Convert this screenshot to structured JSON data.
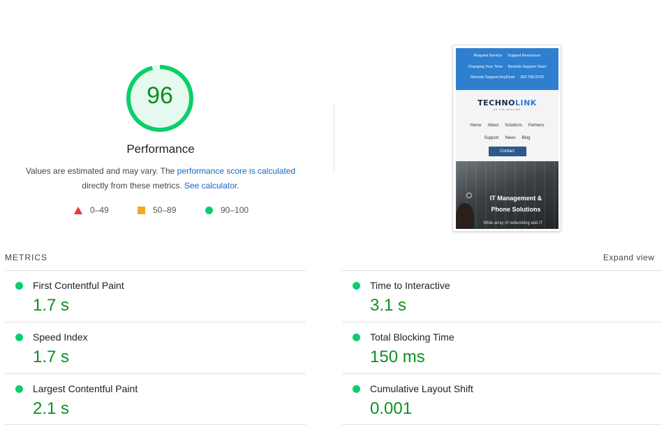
{
  "score": {
    "value": "96",
    "fraction": 0.96,
    "color": "#0cce6b",
    "track_color": "#e6f9ee",
    "title": "Performance"
  },
  "description": {
    "text1": "Values are estimated and may vary. The ",
    "link1": "performance score is calculated",
    "text2": "directly from these metrics. ",
    "link2": "See calculator",
    "text3": "."
  },
  "legend": [
    {
      "range": "0–49",
      "icon": "triangle",
      "color": "#e53935"
    },
    {
      "range": "50–89",
      "icon": "square",
      "color": "#f5a623"
    },
    {
      "range": "90–100",
      "icon": "circle",
      "color": "#0cce6b"
    }
  ],
  "screenshot": {
    "top_links_row1": [
      "Request Service",
      "Support Resources"
    ],
    "top_links_row2": [
      "Changing Your Time",
      "Remote Support Team"
    ],
    "top_links_row3": [
      "Remote Support AnyDesk",
      "303.790.8703"
    ],
    "logo_part1": "TECHNO",
    "logo_part2": "LINK",
    "logo_sub": "OF THE ROCKIES",
    "nav_row1": [
      "Home",
      "About",
      "Solutions",
      "Partners"
    ],
    "nav_row2": [
      "Support",
      "News",
      "Blog"
    ],
    "contact": "Contact",
    "hero_title_line1": "IT Management &",
    "hero_title_line2": "Phone Solutions",
    "hero_sub": "Wide array of networking and IT"
  },
  "metrics": {
    "heading": "METRICS",
    "expand_label": "Expand view",
    "left": [
      {
        "label": "First Contentful Paint",
        "value": "1.7 s"
      },
      {
        "label": "Speed Index",
        "value": "1.7 s"
      },
      {
        "label": "Largest Contentful Paint",
        "value": "2.1 s"
      }
    ],
    "right": [
      {
        "label": "Time to Interactive",
        "value": "3.1 s"
      },
      {
        "label": "Total Blocking Time",
        "value": "150 ms"
      },
      {
        "label": "Cumulative Layout Shift",
        "value": "0.001"
      }
    ]
  }
}
